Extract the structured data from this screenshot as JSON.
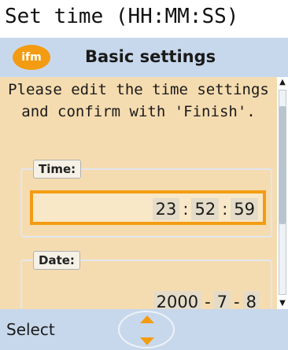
{
  "screen_title": "Set time (HH:MM:SS)",
  "header": {
    "logo_text": "ifm",
    "title": "Basic settings"
  },
  "instructions": "Please edit the time settings and confirm with 'Finish'.",
  "time_field": {
    "label": "Time:",
    "hours": "23",
    "minutes": "52",
    "seconds": "59",
    "separator": ":"
  },
  "date_field": {
    "label": "Date:",
    "year": "2000",
    "month": "7",
    "day": "8",
    "separator": "-"
  },
  "footer": {
    "select_label": "Select"
  },
  "icons": {
    "logo": "ifm-logo-icon",
    "nav_up": "chevron-up-icon",
    "nav_down": "chevron-down-icon",
    "scroll_up": "scroll-up-arrow-icon",
    "scroll_down": "scroll-down-arrow-icon"
  },
  "colors": {
    "accent": "#f39c12",
    "header_bg": "#c8d8ec",
    "content_bg": "#f5dcb0"
  }
}
